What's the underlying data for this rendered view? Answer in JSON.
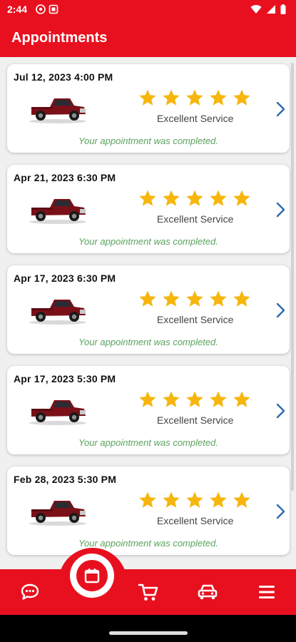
{
  "status": {
    "time": "2:44"
  },
  "header": {
    "title": "Appointments"
  },
  "colors": {
    "brand_red": "#e8101f",
    "star_gold": "#f6b60d",
    "completed_green": "#5aa25e",
    "chevron_blue": "#2b6cb0"
  },
  "appointments": [
    {
      "date": "Jul 12, 2023",
      "time": "4:00 PM",
      "rating": 5,
      "rating_label": "Excellent Service",
      "status": "Your appointment was completed."
    },
    {
      "date": "Apr 21, 2023",
      "time": "6:30 PM",
      "rating": 5,
      "rating_label": "Excellent Service",
      "status": "Your appointment was completed."
    },
    {
      "date": "Apr 17, 2023",
      "time": "6:30 PM",
      "rating": 5,
      "rating_label": "Excellent Service",
      "status": "Your appointment was completed."
    },
    {
      "date": "Apr 17, 2023",
      "time": "5:30 PM",
      "rating": 5,
      "rating_label": "Excellent Service",
      "status": "Your appointment was completed."
    },
    {
      "date": "Feb 28, 2023",
      "time": "5:30 PM",
      "rating": 5,
      "rating_label": "Excellent Service",
      "status": "Your appointment was completed."
    }
  ],
  "bottom_nav": {
    "items": [
      {
        "icon": "chat-icon"
      },
      {
        "icon": "calendar-icon",
        "active": true
      },
      {
        "icon": "cart-icon"
      },
      {
        "icon": "car-icon"
      },
      {
        "icon": "menu-icon"
      }
    ]
  }
}
